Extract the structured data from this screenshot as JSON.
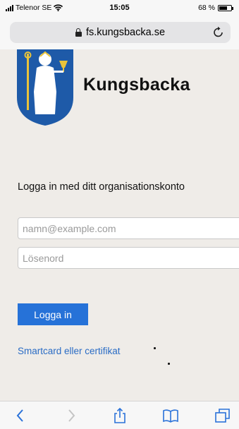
{
  "status_bar": {
    "carrier": "Telenor SE",
    "time": "15:05",
    "battery": "68 %",
    "battery_level": 0.68
  },
  "browser": {
    "url": "fs.kungsbacka.se",
    "icons": {
      "lock": "lock-icon",
      "reload": "reload-icon",
      "back": "back-chevron-icon",
      "forward": "forward-chevron-icon",
      "share": "share-icon",
      "bookmarks": "bookmarks-book-icon",
      "tabs": "tabs-icon"
    }
  },
  "page": {
    "brand": "Kungsbacka",
    "heading": "Logga in med ditt organisationskonto",
    "email_placeholder": "namn@example.com",
    "password_placeholder": "Lösenord",
    "login_label": "Logga in",
    "alt_login_link": "Smartcard eller certifikat"
  },
  "colors": {
    "page_background": "#efece8",
    "primary_button": "#2672d8",
    "link": "#2a6cc5",
    "crest_blue": "#1e5aa8"
  }
}
